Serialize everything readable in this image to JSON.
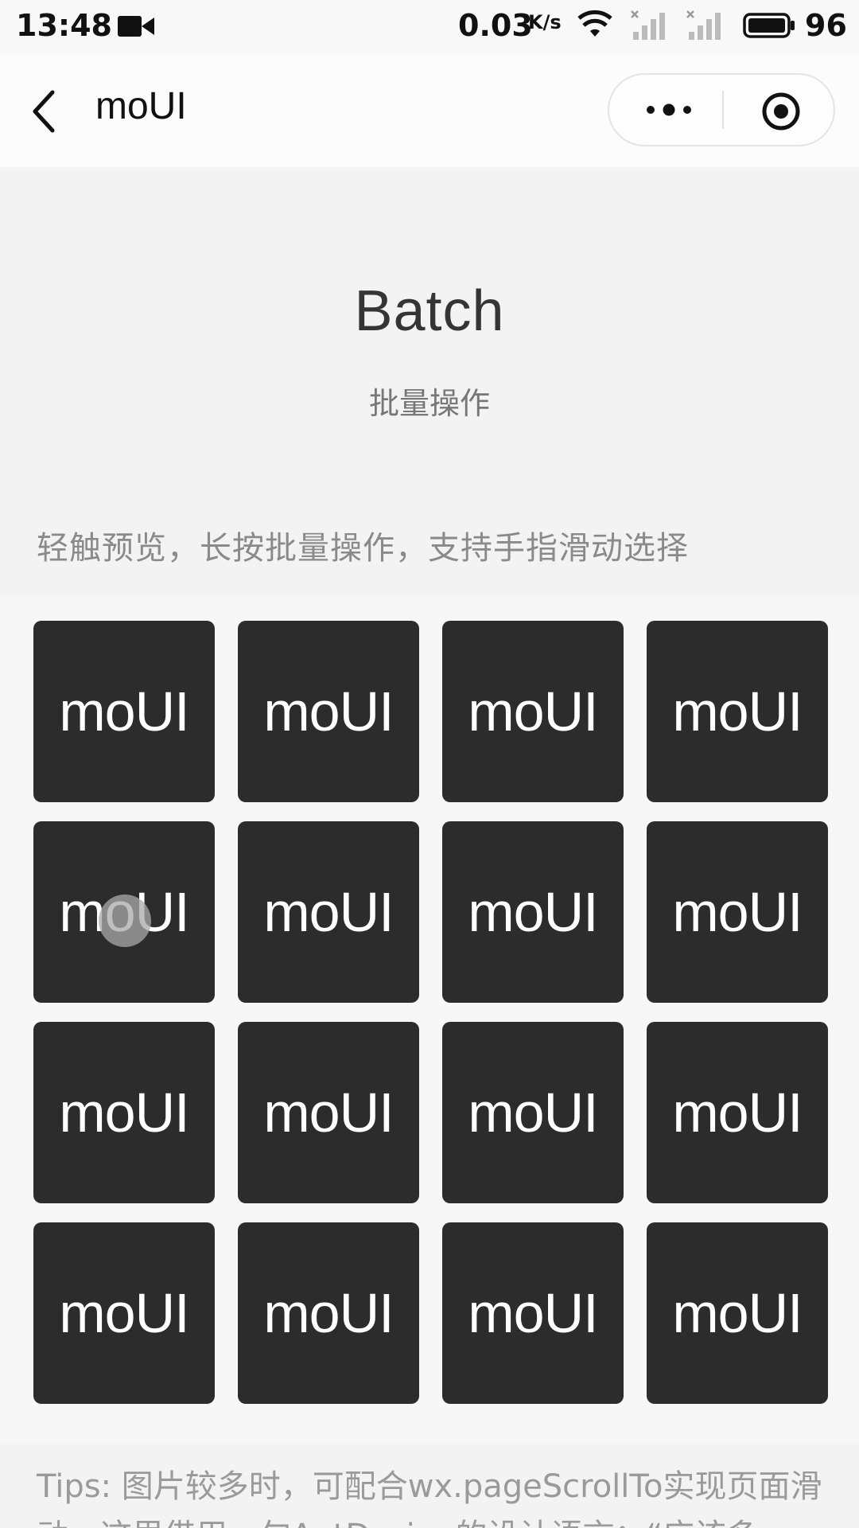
{
  "status_bar": {
    "time": "13:48",
    "net_speed": "0.03",
    "net_speed_unit": "K/s",
    "battery": "96"
  },
  "nav": {
    "title": "moUI"
  },
  "header": {
    "title": "Batch",
    "subtitle": "批量操作",
    "instruction": "轻触预览，长按批量操作，支持手指滑动选择"
  },
  "grid": {
    "tiles": [
      "moUI",
      "moUI",
      "moUI",
      "moUI",
      "moUI",
      "moUI",
      "moUI",
      "moUI",
      "moUI",
      "moUI",
      "moUI",
      "moUI",
      "moUI",
      "moUI",
      "moUI",
      "moUI"
    ]
  },
  "footer": {
    "tips": "Tips: 图片较多时，可配合wx.pageScrollTo实现页面滑动，这里借用一句AntDesign的设计语言：“应该多"
  },
  "colors": {
    "tile_bg": "#2c2c2c",
    "page_bg": "#f3f3f3"
  }
}
